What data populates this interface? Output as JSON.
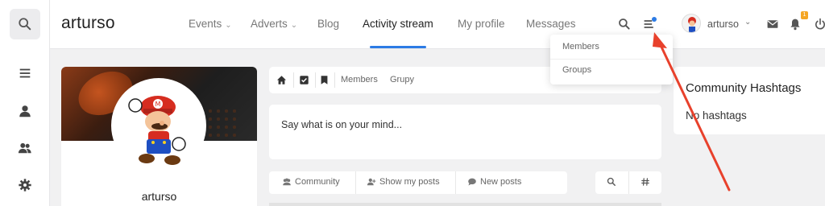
{
  "brand": "arturso",
  "nav": {
    "events": "Events",
    "adverts": "Adverts",
    "blog": "Blog",
    "activity": "Activity stream",
    "profile": "My profile",
    "messages": "Messages"
  },
  "user": {
    "name": "arturso",
    "notification_count": "1"
  },
  "dropdown": {
    "members": "Members",
    "groups": "Groups"
  },
  "profile": {
    "name": "arturso"
  },
  "sharebar": {
    "members": "Members",
    "groups": "Grupy"
  },
  "composer": {
    "placeholder": "Say what is on your mind..."
  },
  "filters": {
    "community": "Community",
    "show_my_posts": "Show my posts",
    "new_posts": "New posts"
  },
  "hashtags": {
    "title": "Community Hashtags",
    "empty": "No hashtags"
  },
  "colors": {
    "accent": "#2c7be5",
    "annotation_arrow": "#e8412c",
    "badge": "#f5a623"
  },
  "icons": [
    "search-icon",
    "menu-icon",
    "user-icon",
    "users-icon",
    "gear-icon",
    "list-icon",
    "envelope-icon",
    "bell-icon",
    "power-icon",
    "home-icon",
    "checkbox-icon",
    "bookmark-icon",
    "hash-icon"
  ]
}
